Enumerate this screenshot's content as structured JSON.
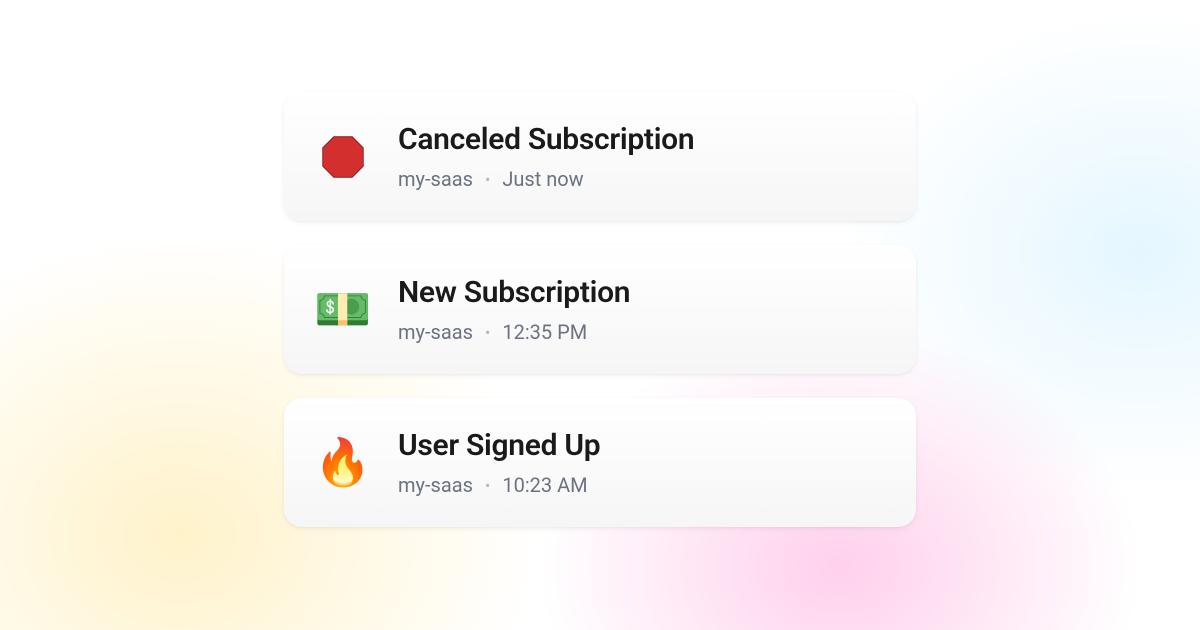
{
  "notifications": [
    {
      "icon": "stop-sign",
      "title": "Canceled Subscription",
      "project": "my-saas",
      "time": "Just now"
    },
    {
      "icon": "money",
      "emoji": "💵",
      "title": "New Subscription",
      "project": "my-saas",
      "time": "12:35 PM"
    },
    {
      "icon": "fire",
      "emoji": "🔥",
      "title": "User Signed Up",
      "project": "my-saas",
      "time": "10:23 AM"
    }
  ]
}
